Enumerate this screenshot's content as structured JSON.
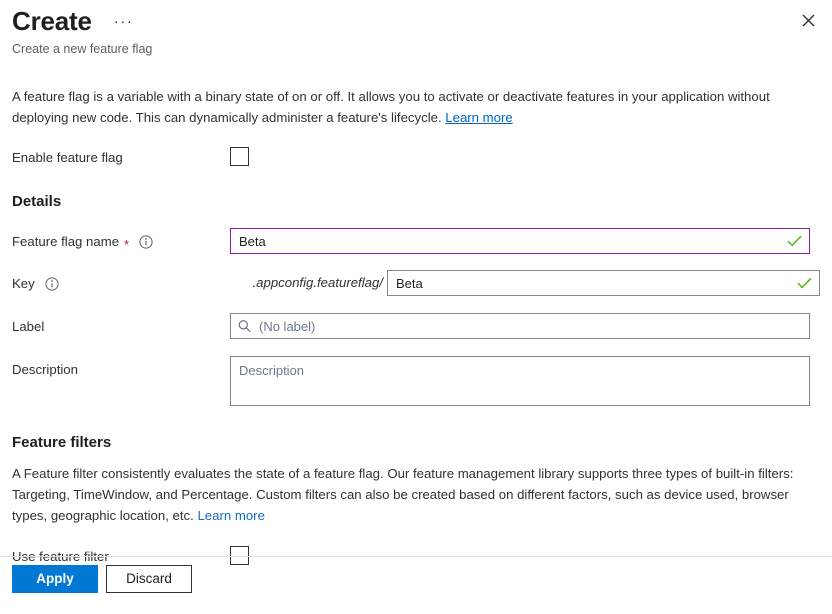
{
  "header": {
    "title": "Create",
    "ellipsis_label": "···",
    "subtitle": "Create a new feature flag",
    "close_icon": "close-icon"
  },
  "intro": {
    "text": "A feature flag is a variable with a binary state of on or off. It allows you to activate or deactivate features in your application without deploying new code. This can dynamically administer a feature's lifecycle. ",
    "link_label": "Learn more"
  },
  "enable_feature_flag": {
    "label": "Enable feature flag",
    "checked": false
  },
  "details": {
    "heading": "Details",
    "feature_flag_name": {
      "label": "Feature flag name",
      "required_marker": "*",
      "info_icon": "info-icon",
      "value": "Beta",
      "placeholder": "",
      "valid": true,
      "focused": true
    },
    "key": {
      "label": "Key",
      "info_icon": "info-icon",
      "prefix": ".appconfig.featureflag/",
      "value": "Beta",
      "placeholder": "",
      "valid": true
    },
    "label_field": {
      "label": "Label",
      "value": "",
      "placeholder": "(No label)",
      "search_icon": "search-icon"
    },
    "description_field": {
      "label": "Description",
      "value": "",
      "placeholder": "Description"
    }
  },
  "feature_filters": {
    "heading": "Feature filters",
    "text": "A Feature filter consistently evaluates the state of a feature flag. Our feature management library supports three types of built-in filters: Targeting, TimeWindow, and Percentage. Custom filters can also be created based on different factors, such as device used, browser types, geographic location, etc. ",
    "link_label": "Learn more",
    "use_feature_filter": {
      "label": "Use feature filter",
      "checked": false
    }
  },
  "footer": {
    "apply_label": "Apply",
    "discard_label": "Discard"
  },
  "colors": {
    "accent_blue": "#0078d4",
    "link_blue": "#0064c8",
    "focus_purple": "#8f1aa5",
    "valid_green": "#5eb525",
    "required_red": "#a4262c"
  }
}
